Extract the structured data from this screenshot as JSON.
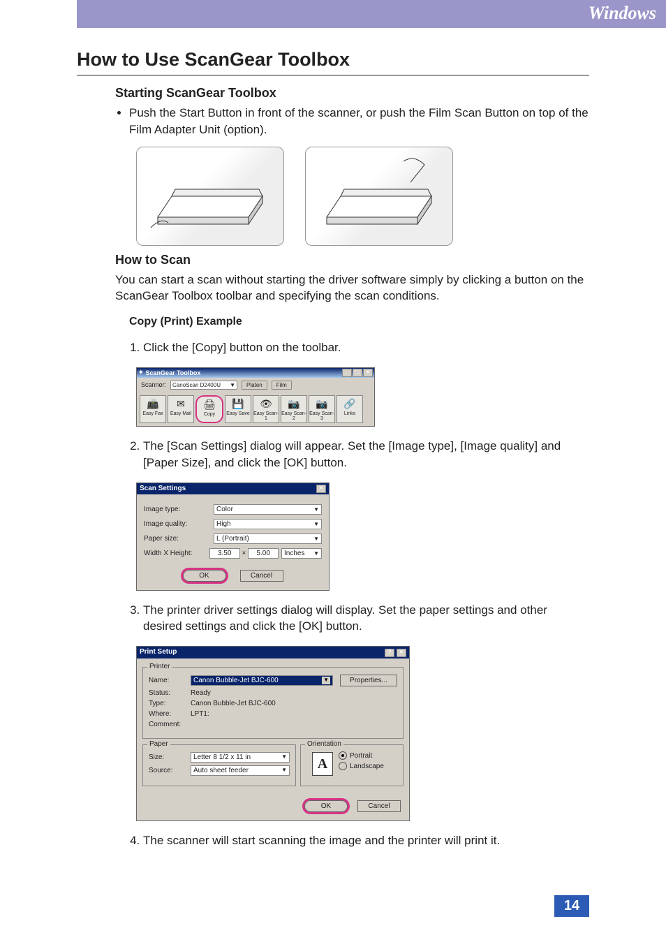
{
  "platform": "Windows",
  "title": "How to Use ScanGear Toolbox",
  "section_starting": {
    "heading": "Starting ScanGear Toolbox",
    "bullet": "Push the Start Button in front of the scanner, or push the Film Scan Button on top of the Film Adapter Unit (option)."
  },
  "section_howtoscan": {
    "heading": "How to Scan",
    "para": "You can start a scan without starting the driver software simply by clicking a button on the ScanGear Toolbox toolbar and specifying the scan conditions."
  },
  "copy_example": {
    "heading": "Copy (Print) Example",
    "steps": [
      "Click the [Copy] button on the toolbar.",
      "The [Scan Settings] dialog will appear. Set the [Image type], [Image quality] and [Paper Size], and click the [OK] button.",
      "The printer driver settings dialog will display. Set the paper settings and other desired settings and click the [OK] button.",
      "The scanner will start scanning the image and the printer will print it."
    ]
  },
  "sg_toolbox": {
    "title": "ScanGear Toolbox",
    "scanner_label": "Scanner:",
    "scanner_value": "CanoScan D2400U",
    "tabs": [
      "Platen",
      "Film"
    ],
    "buttons": [
      {
        "label": "Easy Fax",
        "icon": "📠"
      },
      {
        "label": "Easy Mail",
        "icon": "✉"
      },
      {
        "label": "Copy",
        "icon": "🖨",
        "highlighted": true
      },
      {
        "label": "Easy Save",
        "icon": "💾"
      },
      {
        "label": "Easy Scan-1",
        "icon": "👁"
      },
      {
        "label": "Easy Scan-2",
        "icon": "📷"
      },
      {
        "label": "Easy Scan-3",
        "icon": "📷"
      },
      {
        "label": "Links",
        "icon": "🔗"
      }
    ]
  },
  "scan_settings": {
    "title": "Scan Settings",
    "rows": {
      "image_type": {
        "label": "Image type:",
        "value": "Color"
      },
      "image_quality": {
        "label": "Image quality:",
        "value": "High"
      },
      "paper_size": {
        "label": "Paper size:",
        "value": "L (Portrait)"
      },
      "width_height": {
        "label": "Width X Height:",
        "width": "3.50",
        "times": "×",
        "height": "5.00",
        "unit": "Inches"
      }
    },
    "ok": "OK",
    "cancel": "Cancel"
  },
  "print_setup": {
    "title": "Print Setup",
    "printer": {
      "legend": "Printer",
      "name_label": "Name:",
      "name_value": "Canon Bubble-Jet BJC-600",
      "properties": "Properties...",
      "status_label": "Status:",
      "status_value": "Ready",
      "type_label": "Type:",
      "type_value": "Canon Bubble-Jet BJC-600",
      "where_label": "Where:",
      "where_value": "LPT1:",
      "comment_label": "Comment:"
    },
    "paper": {
      "legend": "Paper",
      "size_label": "Size:",
      "size_value": "Letter 8 1/2 x 11 in",
      "source_label": "Source:",
      "source_value": "Auto sheet feeder"
    },
    "orientation": {
      "legend": "Orientation",
      "portrait": "Portrait",
      "landscape": "Landscape",
      "glyph": "A"
    },
    "ok": "OK",
    "cancel": "Cancel"
  },
  "page_number": "14"
}
